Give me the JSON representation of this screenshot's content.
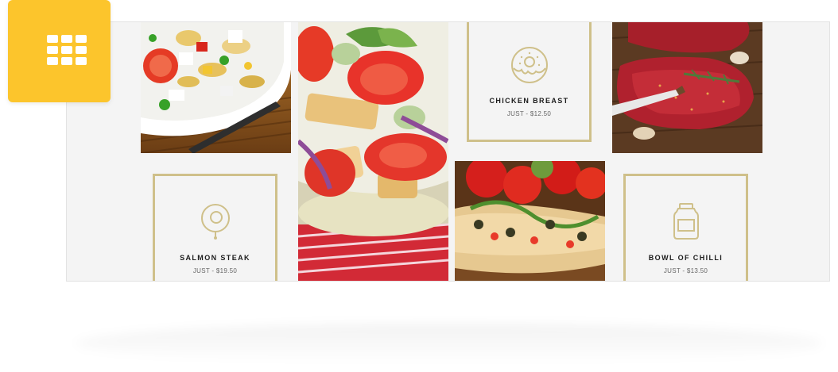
{
  "colors": {
    "accent": "#fcc52c",
    "frame": "#cfc08a",
    "panel": "#f4f4f4"
  },
  "badge": {
    "icon": "grid-menu-icon"
  },
  "gallery": {
    "images": [
      {
        "name": "pasta-salad-image"
      },
      {
        "name": "tomato-bread-salad-image"
      },
      {
        "name": "raw-steak-image"
      },
      {
        "name": "tomato-flatbread-image"
      }
    ],
    "cards": [
      {
        "title": "CHICKEN BREAST",
        "price": "JUST - $12.50",
        "icon": "donut-icon"
      },
      {
        "title": "SALMON STEAK",
        "price": "JUST - $19.50",
        "icon": "egg-icon"
      },
      {
        "title": "BOWL OF CHILLI",
        "price": "JUST - $13.50",
        "icon": "jar-icon"
      }
    ]
  }
}
